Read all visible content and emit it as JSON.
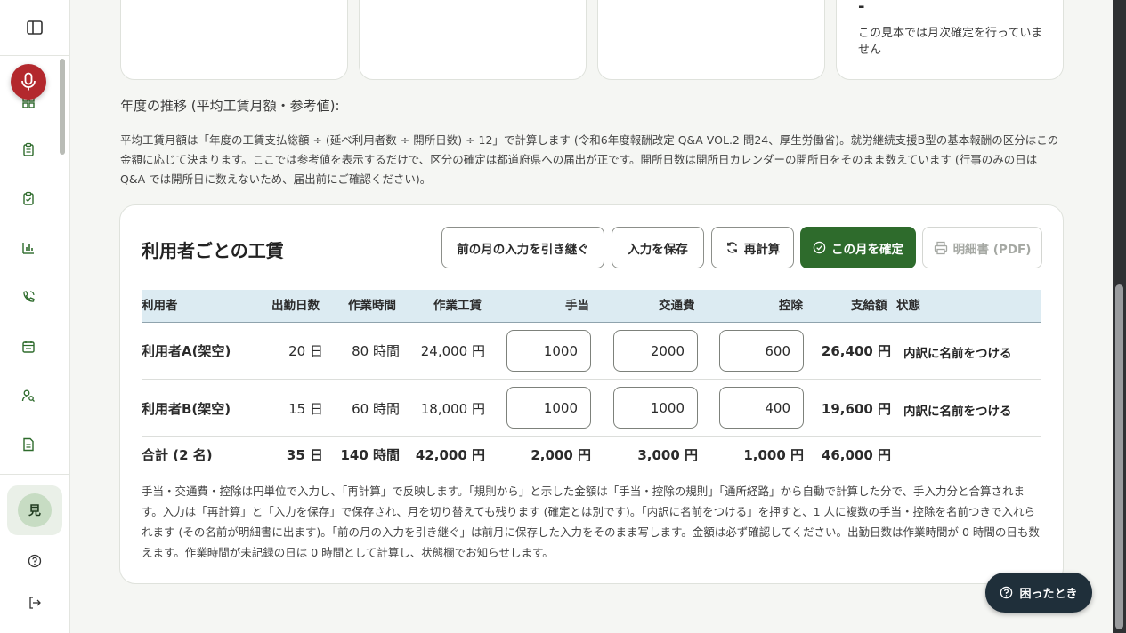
{
  "summary_cards": [
    {
      "value": "",
      "note": ""
    },
    {
      "value": "",
      "note": ""
    },
    {
      "value": "",
      "note": ""
    },
    {
      "value": "-",
      "note": "この見本では月次確定を行っていません"
    }
  ],
  "trend": {
    "title": "年度の推移 (平均工賃月額・参考値):",
    "description": "平均工賃月額は「年度の工賃支払総額 ÷ (延べ利用者数 ÷ 開所日数) ÷ 12」で計算します (令和6年度報酬改定 Q&A VOL.2 問24、厚生労働省)。就労継続支援B型の基本報酬の区分はこの金額に応じて決まります。ここでは参考値を表示するだけで、区分の確定は都道府県への届出が正です。開所日数は開所日カレンダーの開所日をそのまま数えています (行事のみの日は Q&A では開所日に数えないため、届出前にご確認ください)。"
  },
  "wages": {
    "title": "利用者ごとの工賃",
    "buttons": {
      "carry_over": "前の月の入力を引き継ぐ",
      "save": "入力を保存",
      "recalc": "再計算",
      "confirm": "この月を確定",
      "pdf": "明細書 (PDF)"
    },
    "columns": [
      "利用者",
      "出勤日数",
      "作業時間",
      "作業工賃",
      "手当",
      "交通費",
      "控除",
      "支給額",
      "状態"
    ],
    "rows": [
      {
        "name": "利用者A(架空)",
        "days": "20 日",
        "hours": "80 時間",
        "work_wage": "24,000 円",
        "allowance": "1000",
        "transport": "2000",
        "deduction": "600",
        "pay": "26,400 円",
        "status_action": "内訳に名前をつける"
      },
      {
        "name": "利用者B(架空)",
        "days": "15 日",
        "hours": "60 時間",
        "work_wage": "18,000 円",
        "allowance": "1000",
        "transport": "1000",
        "deduction": "400",
        "pay": "19,600 円",
        "status_action": "内訳に名前をつける"
      }
    ],
    "total": {
      "label": "合計 (2 名)",
      "days": "35 日",
      "hours": "140 時間",
      "work_wage": "42,000 円",
      "allowance": "2,000 円",
      "transport": "3,000 円",
      "deduction": "1,000 円",
      "pay": "46,000 円"
    },
    "footnote": "手当・交通費・控除は円単位で入力し、「再計算」で反映します。「規則から」と示した金額は「手当・控除の規則」「通所経路」から自動で計算した分で、手入力分と合算されます。入力は「再計算」と「入力を保存」で保存され、月を切り替えても残ります (確定とは別です)。「内訳に名前をつける」を押すと、1 人に複数の手当・控除を名前つきで入れられます (その名前が明細書に出ます)。「前の月の入力を引き継ぐ」は前月に保存した入力をそのまま写します。金額は必ず確認してください。出勤日数は作業時間が 0 時間の日も数えます。作業時間が未記録の日は 0 時間として計算し、状態欄でお知らせします。"
  },
  "sidebar": {
    "user_initial": "見"
  },
  "help_button": "困ったとき",
  "colors": {
    "primary": "#2e6b2c",
    "mic": "#b3282d",
    "help": "#1f2f3a",
    "table_header": "#dcebf2"
  }
}
